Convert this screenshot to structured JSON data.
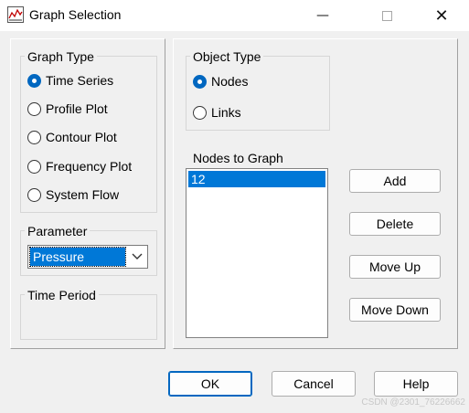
{
  "window": {
    "title": "Graph Selection",
    "minimize_glyph": "—",
    "close_glyph": "✕"
  },
  "graph_type": {
    "label": "Graph Type",
    "options": [
      {
        "label": "Time Series",
        "checked": true
      },
      {
        "label": "Profile Plot",
        "checked": false
      },
      {
        "label": "Contour Plot",
        "checked": false
      },
      {
        "label": "Frequency Plot",
        "checked": false
      },
      {
        "label": "System Flow",
        "checked": false
      }
    ]
  },
  "parameter": {
    "label": "Parameter",
    "selected": "Pressure"
  },
  "time_period": {
    "label": "Time Period"
  },
  "object_type": {
    "label": "Object Type",
    "options": [
      {
        "label": "Nodes",
        "checked": true
      },
      {
        "label": "Links",
        "checked": false
      }
    ]
  },
  "nodes_to_graph": {
    "label": "Nodes to Graph",
    "items": [
      "12"
    ]
  },
  "side_buttons": {
    "add": "Add",
    "delete": "Delete",
    "move_up": "Move Up",
    "move_down": "Move Down"
  },
  "footer_buttons": {
    "ok": "OK",
    "cancel": "Cancel",
    "help": "Help"
  },
  "watermark": "CSDN @2301_76226662",
  "colors": {
    "accent": "#0067c0",
    "selection": "#0078d7"
  }
}
